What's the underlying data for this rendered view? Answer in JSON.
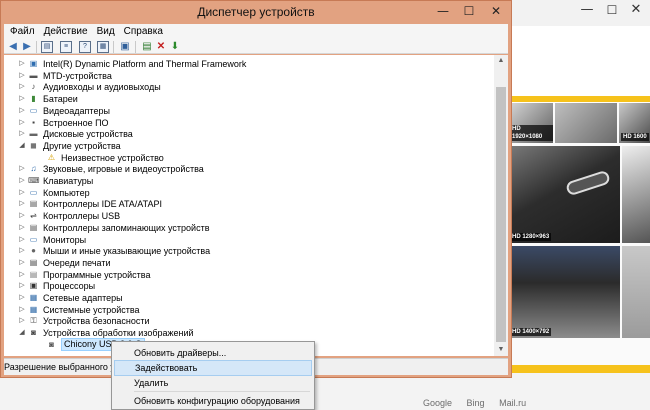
{
  "window": {
    "title": "Диспетчер устройств",
    "minimize": "—",
    "maximize": "☐",
    "close": "✕"
  },
  "menubar": [
    "Файл",
    "Действие",
    "Вид",
    "Справка"
  ],
  "tree": [
    {
      "label": "Intel(R) Dynamic Platform and Thermal Framework",
      "icon": "chip-icon",
      "expanded": false
    },
    {
      "label": "MTD-устройства",
      "icon": "storage-icon",
      "expanded": false
    },
    {
      "label": "Аудиовходы и аудиовыходы",
      "icon": "speaker-icon",
      "expanded": false
    },
    {
      "label": "Батареи",
      "icon": "battery-icon",
      "expanded": false
    },
    {
      "label": "Видеоадаптеры",
      "icon": "display-adapter-icon",
      "expanded": false
    },
    {
      "label": "Встроенное ПО",
      "icon": "firmware-icon",
      "expanded": false
    },
    {
      "label": "Дисковые устройства",
      "icon": "disk-icon",
      "expanded": false
    },
    {
      "label": "Другие устройства",
      "icon": "unknown-device-icon",
      "expanded": true
    },
    {
      "label": "Неизвестное устройство",
      "icon": "warning-device-icon",
      "child": true
    },
    {
      "label": "Звуковые, игровые и видеоустройства",
      "icon": "sound-icon",
      "expanded": false
    },
    {
      "label": "Клавиатуры",
      "icon": "keyboard-icon",
      "expanded": false
    },
    {
      "label": "Компьютер",
      "icon": "computer-icon",
      "expanded": false
    },
    {
      "label": "Контроллеры IDE ATA/ATAPI",
      "icon": "ide-controller-icon",
      "expanded": false
    },
    {
      "label": "Контроллеры USB",
      "icon": "usb-icon",
      "expanded": false
    },
    {
      "label": "Контроллеры запоминающих устройств",
      "icon": "storage-controller-icon",
      "expanded": false
    },
    {
      "label": "Мониторы",
      "icon": "monitor-icon",
      "expanded": false
    },
    {
      "label": "Мыши и иные указывающие устройства",
      "icon": "mouse-icon",
      "expanded": false
    },
    {
      "label": "Очереди печати",
      "icon": "printer-icon",
      "expanded": false
    },
    {
      "label": "Программные устройства",
      "icon": "software-device-icon",
      "expanded": false
    },
    {
      "label": "Процессоры",
      "icon": "processor-icon",
      "expanded": false
    },
    {
      "label": "Сетевые адаптеры",
      "icon": "network-icon",
      "expanded": false
    },
    {
      "label": "Системные устройства",
      "icon": "system-icon",
      "expanded": false
    },
    {
      "label": "Устройства безопасности",
      "icon": "security-icon",
      "expanded": false
    },
    {
      "label": "Устройства обработки изображений",
      "icon": "camera-icon",
      "expanded": true
    },
    {
      "label": "Chicony USB 2.0 C",
      "icon": "webcam-disabled-icon",
      "child": true,
      "selected": true
    }
  ],
  "status": "Разрешение выбранного устро",
  "context_menu": [
    {
      "label": "Обновить драйверы..."
    },
    {
      "label": "Задействовать",
      "hover": true
    },
    {
      "label": "Удалить"
    },
    {
      "label": "Обновить конфигурацию оборудования"
    }
  ],
  "background": {
    "thumbnails": [
      {
        "res": "HD 1920×1080"
      },
      {
        "res": "HD 1600"
      },
      {
        "res": "HD 1280×963"
      },
      {
        "res": "HD 1400×792"
      }
    ],
    "search_links": [
      "Google",
      "Bing",
      "Mail.ru"
    ],
    "colors": {
      "accent": "#f6c21b",
      "window_frame": "#e2a281",
      "menu_hover": "#d5e7f8"
    }
  }
}
